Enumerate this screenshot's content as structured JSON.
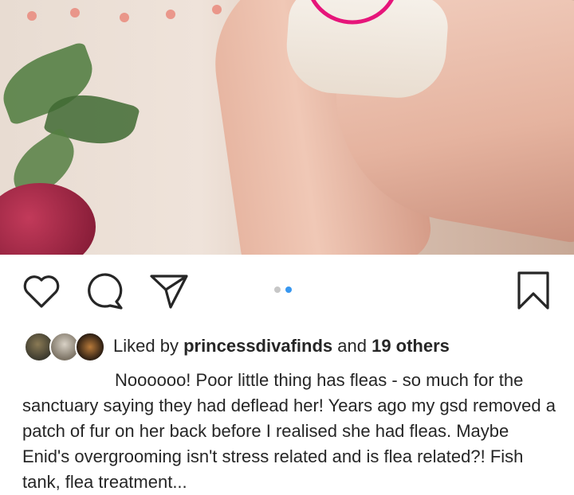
{
  "post": {
    "image_description_icon": "photo-of-fingers-holding-tiny-flea",
    "actions": {
      "like_icon": "heart-outline-icon",
      "comment_icon": "comment-bubble-icon",
      "share_icon": "paper-plane-icon",
      "save_icon": "bookmark-outline-icon"
    },
    "carousel": {
      "count": 2,
      "active_index": 1
    },
    "likes": {
      "prefix": "Liked by ",
      "user": "princessdivafinds",
      "conjunction": " and ",
      "others": "19 others"
    },
    "caption": "Noooooo! Poor little thing has fleas - so much for the sanctuary saying they had deflead her! Years ago my gsd removed a patch of fur on her back before I realised she had fleas. Maybe Enid's overgrooming isn't stress related and is flea related?! Fish tank, flea treatment..."
  },
  "colors": {
    "accent": "#3897f0",
    "highlight_circle": "#e6157a",
    "text": "#262626"
  }
}
